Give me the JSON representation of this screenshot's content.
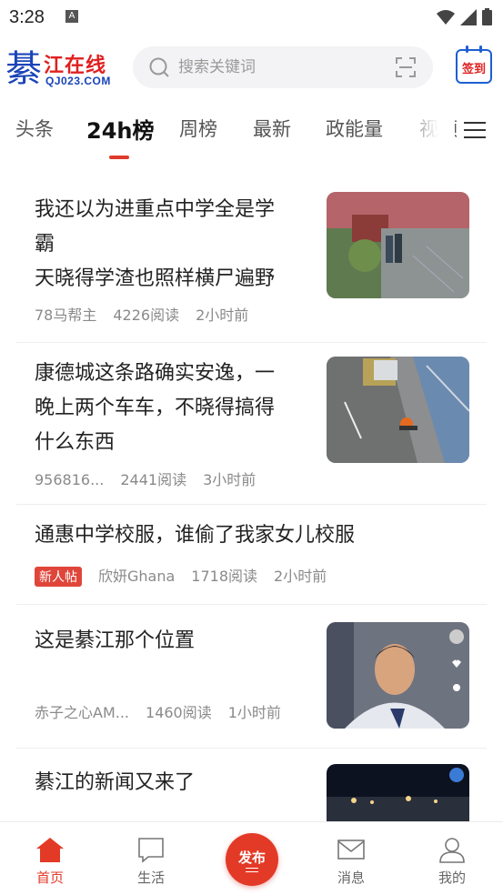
{
  "status_bar": {
    "time": "3:28",
    "notification_letter": "A"
  },
  "header": {
    "logo": {
      "big_char": "綦",
      "name": "江在线",
      "url": "QJ023.COM"
    },
    "search": {
      "placeholder": "搜索关键词"
    },
    "checkin_label": "签到"
  },
  "tabs": [
    {
      "label": "头条",
      "active": false
    },
    {
      "label": "24h榜",
      "active": true
    },
    {
      "label": "周榜",
      "active": false
    },
    {
      "label": "最新",
      "active": false
    },
    {
      "label": "政能量",
      "active": false
    },
    {
      "label": "视频",
      "active": false
    }
  ],
  "feed": [
    {
      "title_lines": [
        "我还以为进重点中学全是学",
        "霸",
        "天晓得学渣也照样横尸遍野"
      ],
      "author": "78马帮主",
      "reads": "4226阅读",
      "time": "2小时前",
      "badge": "",
      "has_thumb": true
    },
    {
      "title_lines": [
        "康德城这条路确实安逸，一",
        "晚上两个车车，不晓得搞得",
        "什么东西"
      ],
      "author": "956816...",
      "reads": "2441阅读",
      "time": "3小时前",
      "badge": "",
      "has_thumb": true
    },
    {
      "title_lines": [
        "通惠中学校服，谁偷了我家女儿校服"
      ],
      "author": "欣妍Ghana",
      "reads": "1718阅读",
      "time": "2小时前",
      "badge": "新人帖",
      "has_thumb": false
    },
    {
      "title_lines": [
        "这是綦江那个位置"
      ],
      "author": "赤子之心AM...",
      "reads": "1460阅读",
      "time": "1小时前",
      "badge": "",
      "has_thumb": true
    },
    {
      "title_lines": [
        "綦江的新闻又来了"
      ],
      "author": "",
      "reads": "",
      "time": "",
      "badge": "",
      "has_thumb": true
    }
  ],
  "bottom_nav": {
    "home": "首页",
    "life": "生活",
    "publish": "发布",
    "messages": "消息",
    "mine": "我的"
  },
  "colors": {
    "accent": "#e33a27",
    "logo_blue": "#1a44b8",
    "checkin_blue": "#1e5fd1"
  }
}
